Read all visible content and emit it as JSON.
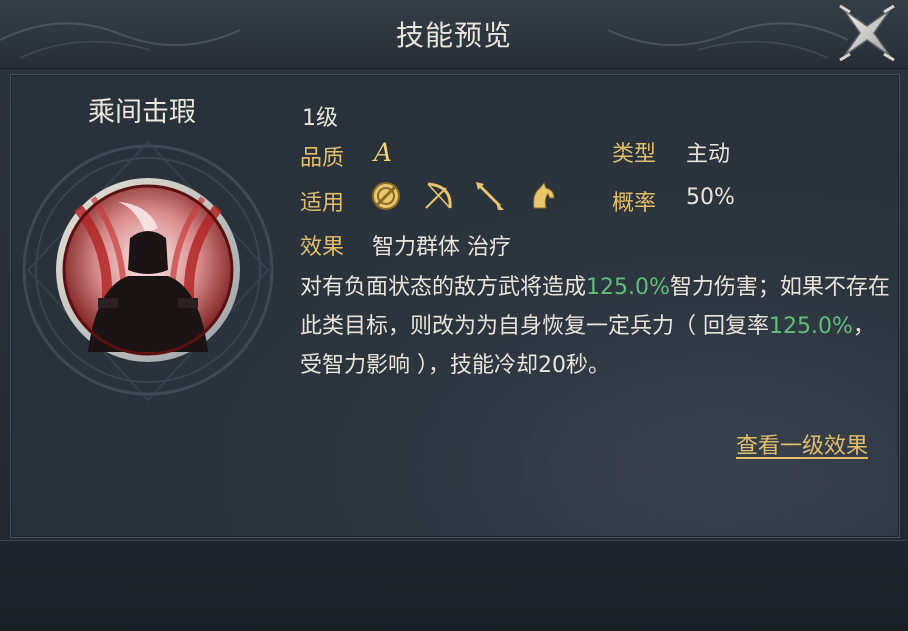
{
  "dialog": {
    "title": "技能预览"
  },
  "skill": {
    "name": "乘间击瑕",
    "level": "1级",
    "quality_label": "品质",
    "quality_value": "A",
    "type_label": "类型",
    "type_value": "主动",
    "applicable_label": "适用",
    "applicable_icons": [
      "shield-icon",
      "bow-icon",
      "spear-icon",
      "horse-icon"
    ],
    "rate_label": "概率",
    "rate_value": "50%",
    "effect_label": "效果",
    "effect_value": "智力群体 治疗",
    "description": {
      "p1": "对有负面状态的敌方武将造成",
      "n1": "125.0%",
      "p2": "智力伤害；如果不存在此类目标，则改为为自身恢复一定兵力（ 回复率",
      "n2": "125.0%",
      "p3": "，受智力影响 ），技能冷却20秒。"
    },
    "link_text": "查看一级效果"
  },
  "colors": {
    "gold_label": "#e2bd6a",
    "green_value": "#5fbf7a",
    "text": "#e8e4da"
  }
}
